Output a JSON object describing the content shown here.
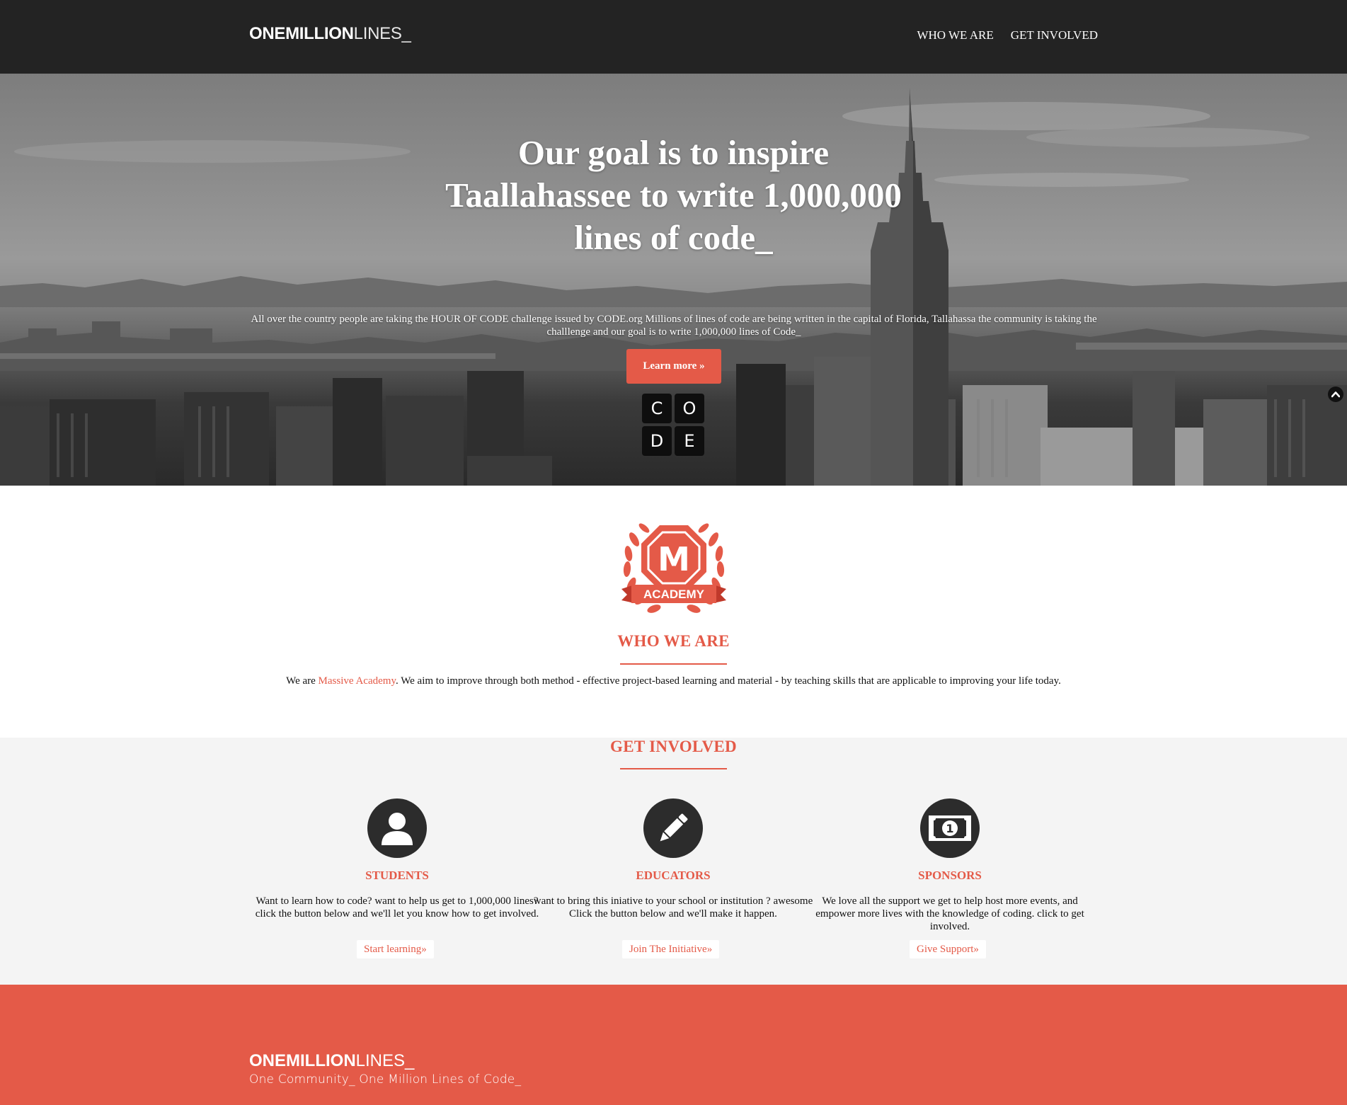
{
  "brand": {
    "logo_bold": "ONEMILLION",
    "logo_light": "LINES_"
  },
  "nav": {
    "items": [
      {
        "label": "WHO WE ARE"
      },
      {
        "label": "GET INVOLVED"
      }
    ]
  },
  "hero": {
    "title_line1": "Our goal is to inspire",
    "title_line2": "Taallahassee to write 1,000,000",
    "title_line3": "lines of code_",
    "description": "All over the country people are taking the HOUR OF CODE challenge issued by CODE.org Millions of lines of code are being written in the capital of Florida, Tallahassa the community is taking the challlenge and our goal is to write 1,000,000 lines of Code_",
    "button_label": "Learn more »",
    "code_tiles": [
      "C",
      "O",
      "D",
      "E"
    ]
  },
  "who": {
    "badge_letter": "M",
    "badge_text": "ACADEMY",
    "title": "WHO WE ARE",
    "text_prefix": "We are ",
    "link": "Massive Academy",
    "text_suffix": ". We aim to improve through both method - effective project-based learning and material - by teaching skills that are applicable to improving your life today."
  },
  "involved": {
    "title": "GET INVOLVED",
    "columns": [
      {
        "icon": "user-icon",
        "title": "STUDENTS",
        "text": "Want to learn how to code? want to help us get to 1,000,000 lines? click the button below and we'll let you know how to get involved.",
        "button": "Start learning»"
      },
      {
        "icon": "pencil-icon",
        "title": "EDUCATORS",
        "text": "want to bring this iniative to your school or institution ? awesome Click the button below and we'll make it happen.",
        "button": "Join The Initiative»"
      },
      {
        "icon": "money-icon",
        "title": "SPONSORS",
        "text": "We love all the support we get to help host more events, and empower more lives with the knowledge of coding. click to get involved.",
        "button": "Give Support»"
      }
    ]
  },
  "footer": {
    "logo_bold": "ONEMILLION",
    "logo_light": "LINES_",
    "tagline": "One Community_ One Million Lines of Code_"
  },
  "colors": {
    "accent": "#e45a48",
    "navbar": "#232323",
    "section_bg": "#f4f4f4"
  }
}
